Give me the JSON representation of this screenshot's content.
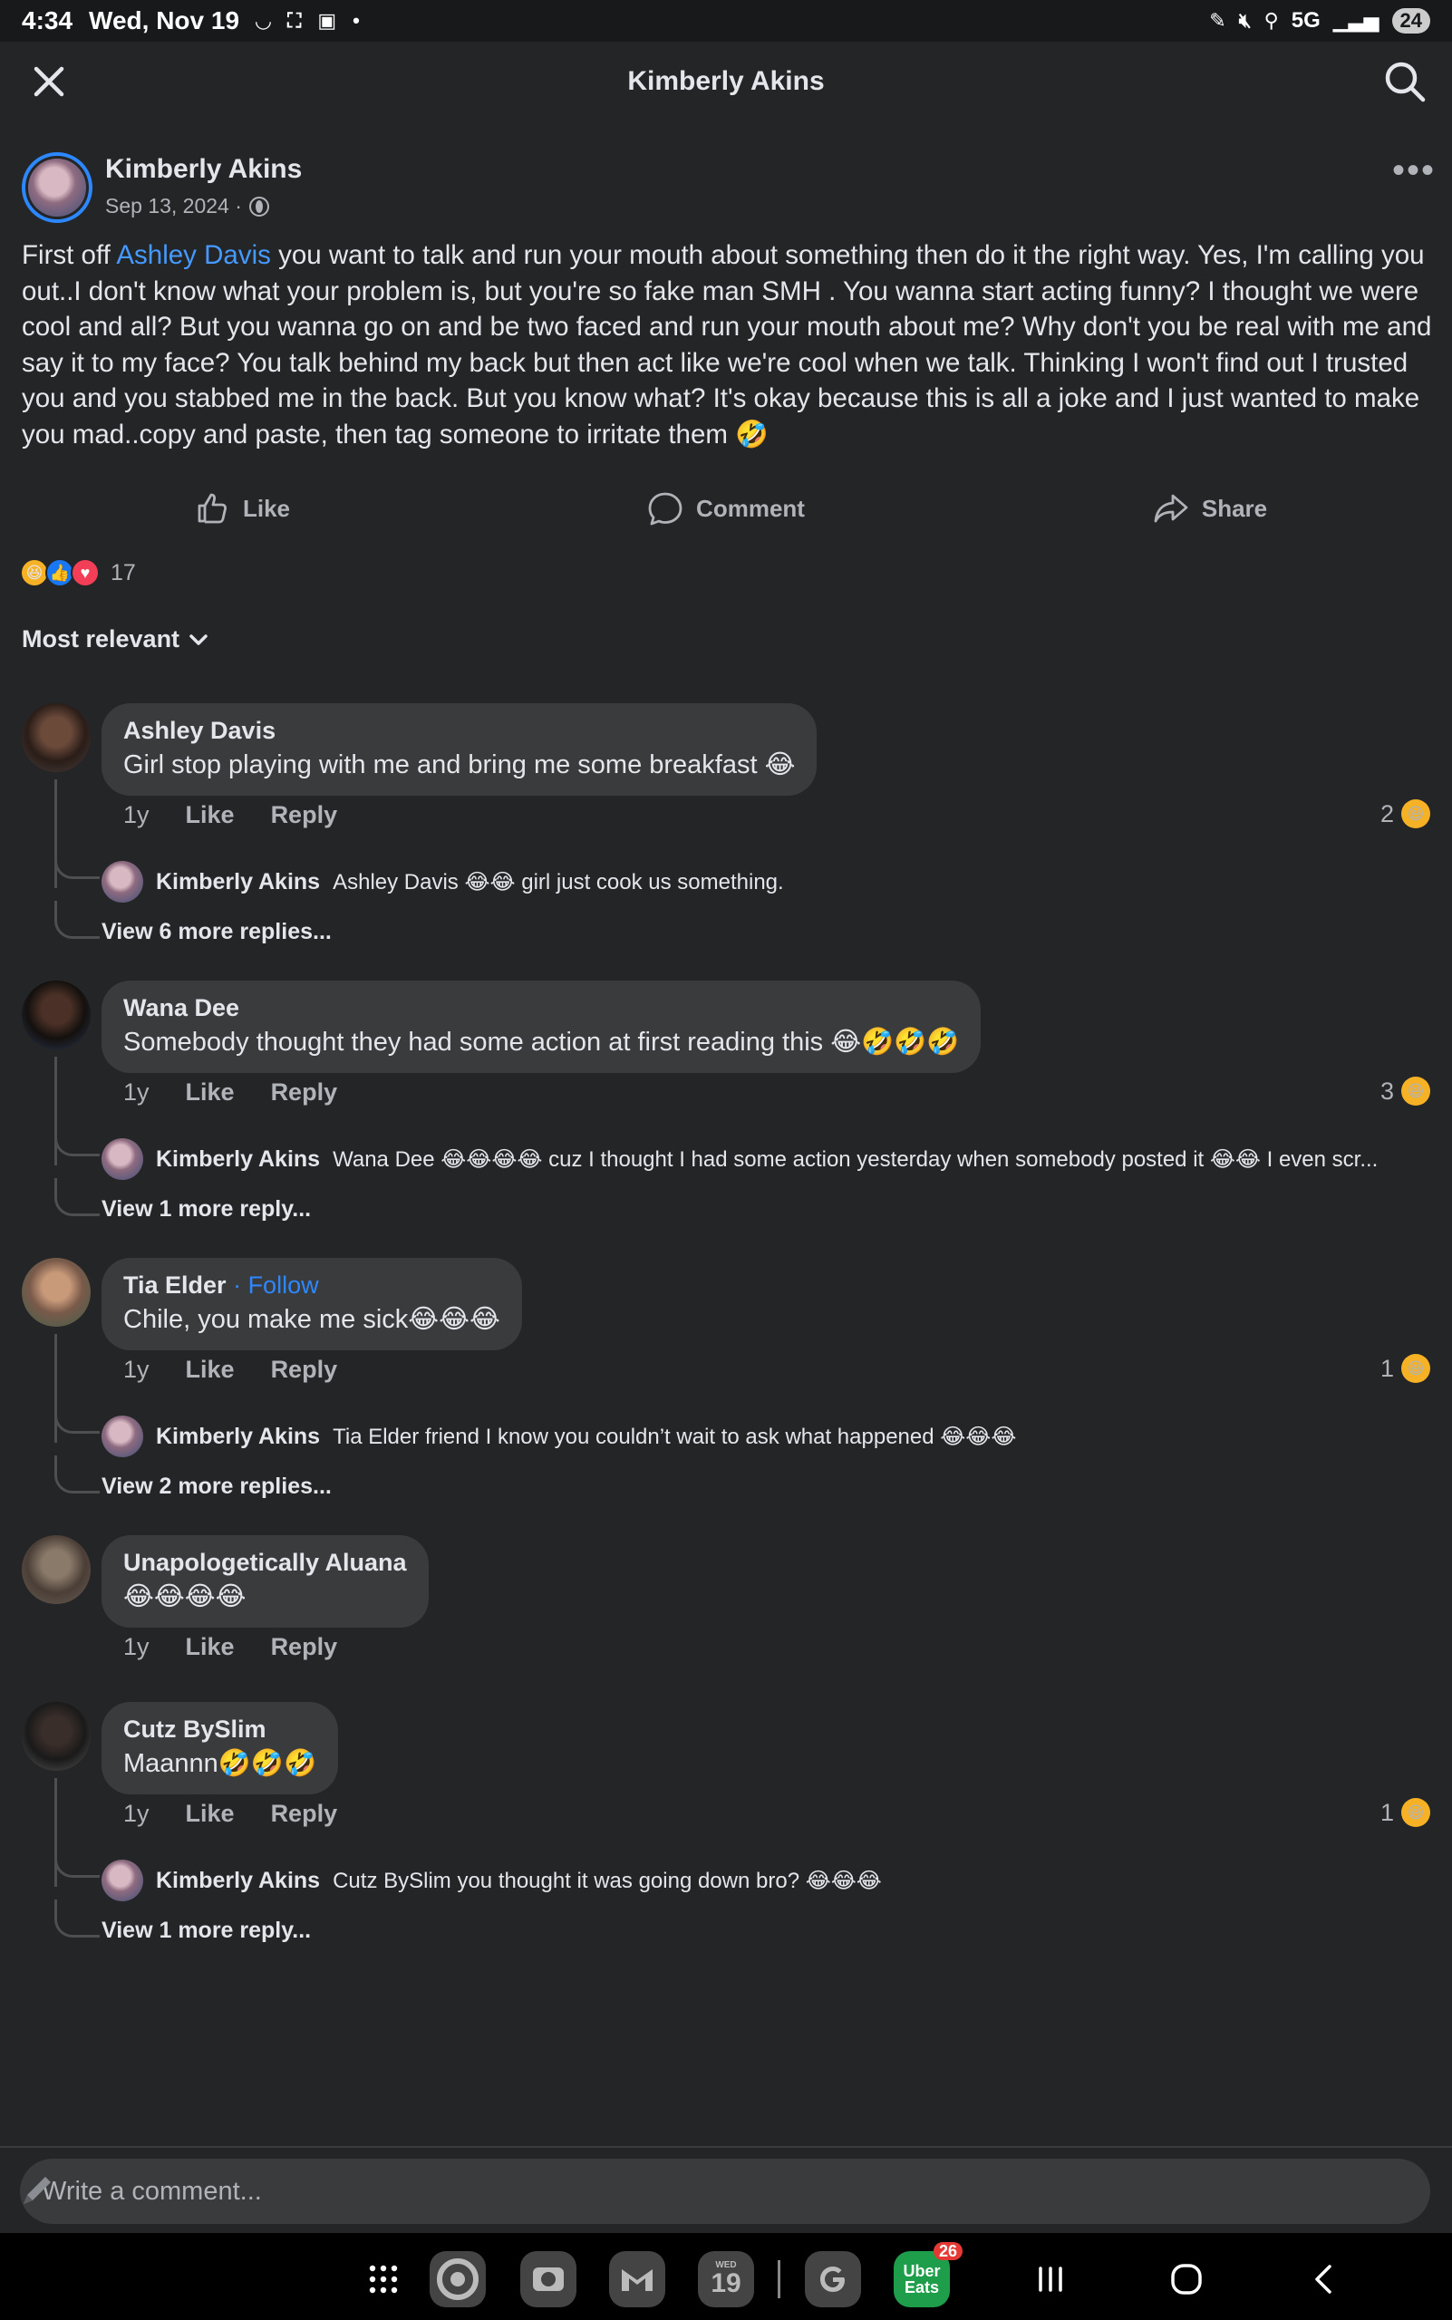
{
  "status_bar": {
    "time": "4:34",
    "date": "Wed, Nov 19",
    "network": "5G",
    "battery": "24"
  },
  "header": {
    "title": "Kimberly Akins"
  },
  "post": {
    "author": "Kimberly Akins",
    "date": "Sep 13, 2024 ·",
    "body_prefix": "First off ",
    "body_mention": "Ashley Davis",
    "body_rest": " you want to talk and run your mouth about something then do it the right way. Yes, I'm calling you out..I don't know what your problem is, but you're so fake man SMH . You wanna start acting funny? I thought we were cool and all? But you wanna go on and be two faced and run your mouth about me? Why don't you be real with me and say it to my face? You talk behind my back but then act like we're cool when we talk. Thinking I won't find out I trusted you and you stabbed me in the back. But you know what? It's okay because this is all a joke and I just wanted to make you mad..copy and paste, then tag someone to irritate them 🤣"
  },
  "actions": {
    "like": "Like",
    "comment": "Comment",
    "share": "Share"
  },
  "reactions": {
    "count": "17"
  },
  "sort": {
    "label": "Most relevant"
  },
  "comments": [
    {
      "name": "Ashley Davis",
      "text": "Girl stop playing with me and bring me some breakfast 😂",
      "time": "1y",
      "like": "Like",
      "reply": "Reply",
      "reaction_count": "2",
      "reply_preview": {
        "name": "Kimberly Akins",
        "text": "Ashley Davis 😂😂 girl just cook us something."
      },
      "view_more": "View 6 more replies..."
    },
    {
      "name": "Wana Dee",
      "text": "Somebody thought they had some action at first reading this 😂🤣🤣🤣",
      "time": "1y",
      "like": "Like",
      "reply": "Reply",
      "reaction_count": "3",
      "reply_preview": {
        "name": "Kimberly Akins",
        "text": "Wana Dee 😂😂😂😂 cuz I thought I had some action yesterday when somebody posted it 😂😂 I even scr..."
      },
      "view_more": "View 1 more reply..."
    },
    {
      "name": "Tia Elder",
      "follow": "Follow",
      "text": "Chile,  you make me sick😂😂😂",
      "time": "1y",
      "like": "Like",
      "reply": "Reply",
      "reaction_count": "1",
      "reply_preview": {
        "name": "Kimberly Akins",
        "text": "Tia Elder friend I know you couldn’t wait to ask what happened 😂😂😂"
      },
      "view_more": "View 2 more replies..."
    },
    {
      "name": "Unapologetically Aluana",
      "text": "😂😂😂😂",
      "time": "1y",
      "like": "Like",
      "reply": "Reply"
    },
    {
      "name": "Cutz BySlim",
      "text": "Maannn🤣🤣🤣",
      "time": "1y",
      "like": "Like",
      "reply": "Reply",
      "reaction_count": "1",
      "reply_preview": {
        "name": "Kimberly Akins",
        "text": "Cutz BySlim you thought it was going down bro? 😂😂😂"
      },
      "view_more": "View 1 more reply..."
    }
  ],
  "compose": {
    "placeholder": "Write a comment..."
  },
  "navbar": {
    "calendar_day": "19",
    "calendar_weekday": "WED",
    "uber_eats_label": "Uber Eats",
    "uber_eats_badge": "26"
  },
  "colors": {
    "background": "#242526",
    "bubble": "#3a3b3c",
    "mention": "#4599ff",
    "follow": "#2d88ff",
    "haha": "#f7b125"
  }
}
